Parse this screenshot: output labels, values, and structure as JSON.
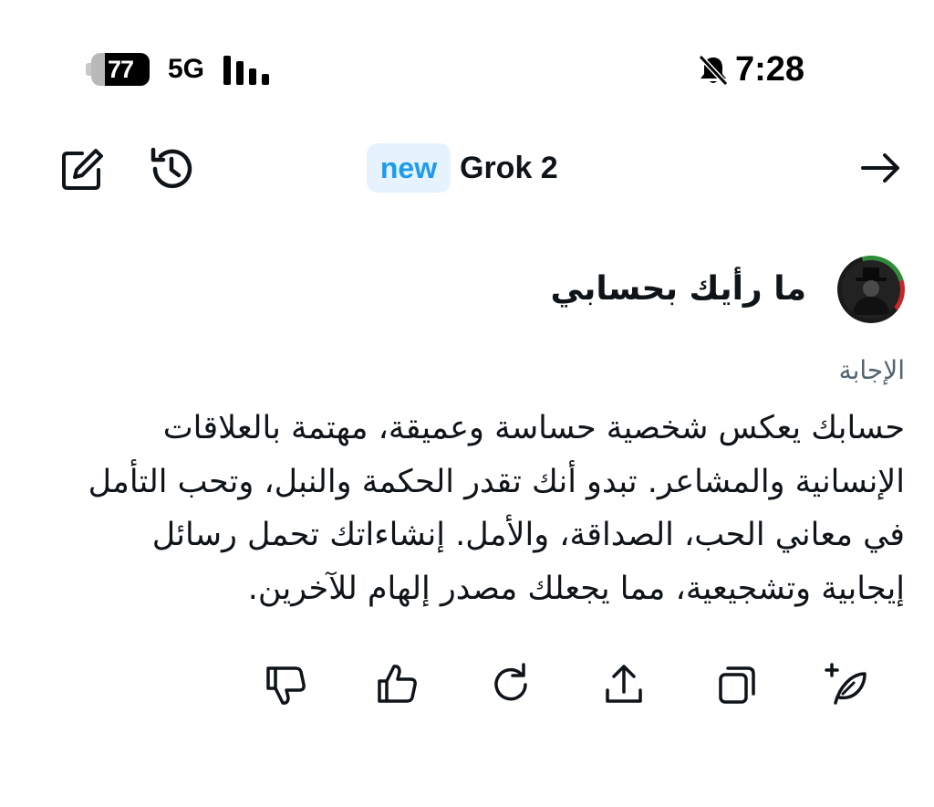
{
  "status_bar": {
    "battery_level": "77",
    "battery_fraction": 0.77,
    "network": "5G",
    "time": "7:28",
    "icons": [
      "battery-icon",
      "signal-bars-icon",
      "bell-off-icon"
    ]
  },
  "header": {
    "badge": "new",
    "title": "Grok 2",
    "icons": [
      "compose-icon",
      "history-icon",
      "arrow-right-icon"
    ]
  },
  "conversation": {
    "question": "ما رأيك بحسابي",
    "answer_label": "الإجابة",
    "answer_text": "حسابك يعكس شخصية حساسة وعميقة، مهتمة بالعلاقات الإنسانية والمشاعر. تبدو أنك تقدر الحكمة والنبل، وتحب التأمل في معاني الحب، الصداقة، والأمل. إنشاءاتك تحمل رسائل إيجابية وتشجيعية، مما يجعلك مصدر إلهام للآخرين."
  },
  "actions": {
    "icons": [
      "thumbs-down-icon",
      "thumbs-up-icon",
      "regenerate-icon",
      "share-icon",
      "copy-icon",
      "new-post-icon"
    ]
  },
  "colors": {
    "text": "#0f1419",
    "secondary_text": "#536471",
    "accent": "#1d9bf0",
    "badge_bg": "#e6f3fe",
    "background": "#ffffff"
  }
}
